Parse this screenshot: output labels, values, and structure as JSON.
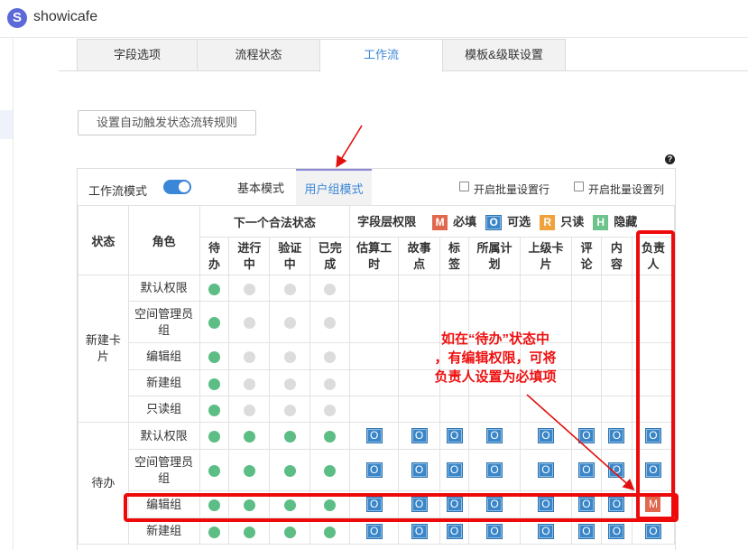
{
  "app": {
    "logo_letter": "S",
    "name": "showicafe"
  },
  "tabs": [
    "字段选项",
    "流程状态",
    "工作流",
    "模板&级联设置"
  ],
  "active_tab": 2,
  "auto_rule_button": "设置自动触发状态流转规则",
  "help_icon": "?",
  "panel": {
    "workflow_mode_label": "工作流模式",
    "workflow_mode_on": true,
    "mode_tabs": [
      "基本模式",
      "用户组模式"
    ],
    "active_mode_tab": 1,
    "batch_row_label": "开启批量设置行",
    "batch_col_label": "开启批量设置列"
  },
  "table": {
    "state_header": "状态",
    "role_header": "角色",
    "next_state_header": "下一个合法状态",
    "field_perm_header": "字段层权限",
    "legend": [
      {
        "letter": "M",
        "label": "必填",
        "color": "#e0684f"
      },
      {
        "letter": "O",
        "label": "可选",
        "color": "#3a86c8"
      },
      {
        "letter": "R",
        "label": "只读",
        "color": "#f0a33d"
      },
      {
        "letter": "H",
        "label": "隐藏",
        "color": "#6cc38c"
      }
    ],
    "state_columns": [
      "待办",
      "进行中",
      "验证中",
      "已完成"
    ],
    "field_columns": [
      "估算工时",
      "故事点",
      "标签",
      "所属计划",
      "上级卡片",
      "评论",
      "内容",
      "负责人"
    ],
    "groups": [
      {
        "state": "新建卡片",
        "rows": [
          {
            "role": "默认权限",
            "dots": [
              1,
              0,
              0,
              0
            ],
            "fields": [
              "",
              "",
              "",
              "",
              "",
              "",
              "",
              ""
            ]
          },
          {
            "role": "空间管理员组",
            "dots": [
              1,
              0,
              0,
              0
            ],
            "fields": [
              "",
              "",
              "",
              "",
              "",
              "",
              "",
              ""
            ]
          },
          {
            "role": "编辑组",
            "dots": [
              1,
              0,
              0,
              0
            ],
            "fields": [
              "",
              "",
              "",
              "",
              "",
              "",
              "",
              ""
            ]
          },
          {
            "role": "新建组",
            "dots": [
              1,
              0,
              0,
              0
            ],
            "fields": [
              "",
              "",
              "",
              "",
              "",
              "",
              "",
              ""
            ]
          },
          {
            "role": "只读组",
            "dots": [
              1,
              0,
              0,
              0
            ],
            "fields": [
              "",
              "",
              "",
              "",
              "",
              "",
              "",
              ""
            ]
          }
        ]
      },
      {
        "state": "待办",
        "rows": [
          {
            "role": "默认权限",
            "dots": [
              1,
              1,
              1,
              1
            ],
            "fields": [
              "O",
              "O",
              "O",
              "O",
              "O",
              "O",
              "O",
              "O"
            ]
          },
          {
            "role": "空间管理员组",
            "dots": [
              1,
              1,
              1,
              1
            ],
            "fields": [
              "O",
              "O",
              "O",
              "O",
              "O",
              "O",
              "O",
              "O"
            ]
          },
          {
            "role": "编辑组",
            "dots": [
              1,
              1,
              1,
              1
            ],
            "fields": [
              "O",
              "O",
              "O",
              "O",
              "O",
              "O",
              "O",
              "M"
            ]
          },
          {
            "role": "新建组",
            "dots": [
              1,
              1,
              1,
              1
            ],
            "fields": [
              "O",
              "O",
              "O",
              "O",
              "O",
              "O",
              "O",
              "O"
            ]
          }
        ]
      }
    ]
  },
  "annotation": {
    "line1": "如在“待办”状态中",
    "line2": "，有编辑权限，可将",
    "line3": "负责人设置为必填项"
  },
  "colors": {
    "accent": "#3a86d8",
    "highlight": "#ee0a0a",
    "dot_on": "#5cbd85",
    "dot_off": "#dcdcdc"
  }
}
